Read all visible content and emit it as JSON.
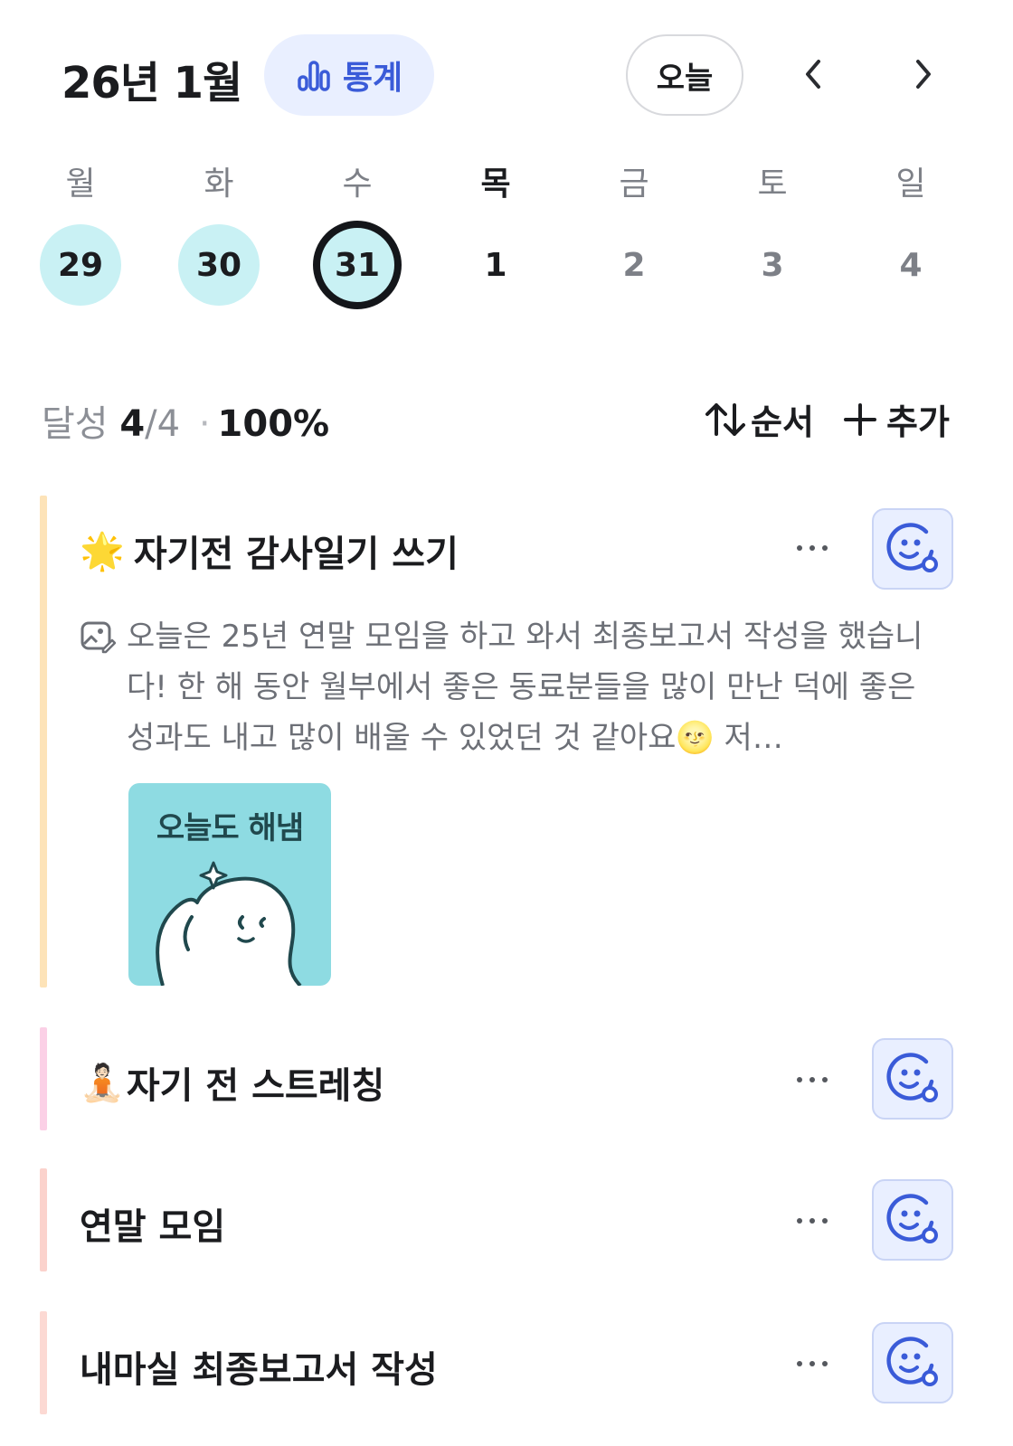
{
  "header": {
    "month_title": "26년 1월",
    "stats_label": "통계",
    "today_label": "오늘"
  },
  "week": {
    "days": [
      {
        "name": "월",
        "num": "29"
      },
      {
        "name": "화",
        "num": "30"
      },
      {
        "name": "수",
        "num": "31"
      },
      {
        "name": "목",
        "num": "1"
      },
      {
        "name": "금",
        "num": "2"
      },
      {
        "name": "토",
        "num": "3"
      },
      {
        "name": "일",
        "num": "4"
      }
    ]
  },
  "achievement": {
    "label": "달성",
    "done": "4",
    "total": "/4",
    "separator": "·",
    "percent": "100%",
    "sort_label": "순서",
    "add_label": "추가"
  },
  "tasks": [
    {
      "title": "자기전 감사일기 쓰기",
      "emoji": "🌟",
      "memo": "오늘은 25년 연말 모임을 하고 와서 최종보고서 작성을 했습니다! 한 해 동안 월부에서 좋은 동료분들을 많이 만난 덕에 좋은 성과도 내고 많이 배울 수 있었던 것 같아요🌝 저…",
      "image_caption": "오늘도 해냄"
    },
    {
      "title": "자기 전 스트레칭",
      "emoji": "🧘🏻"
    },
    {
      "title": "연말 모임"
    },
    {
      "title": "내마실 최종보고서 작성"
    }
  ],
  "colors": {
    "accent": "#3a5bd8",
    "done_day": "#c9f1f4",
    "bar_1": "#fde3b8",
    "bar_2": "#fbd0e6",
    "bar_3": "#fbd2cc",
    "bar_4": "#fcd9d3"
  }
}
